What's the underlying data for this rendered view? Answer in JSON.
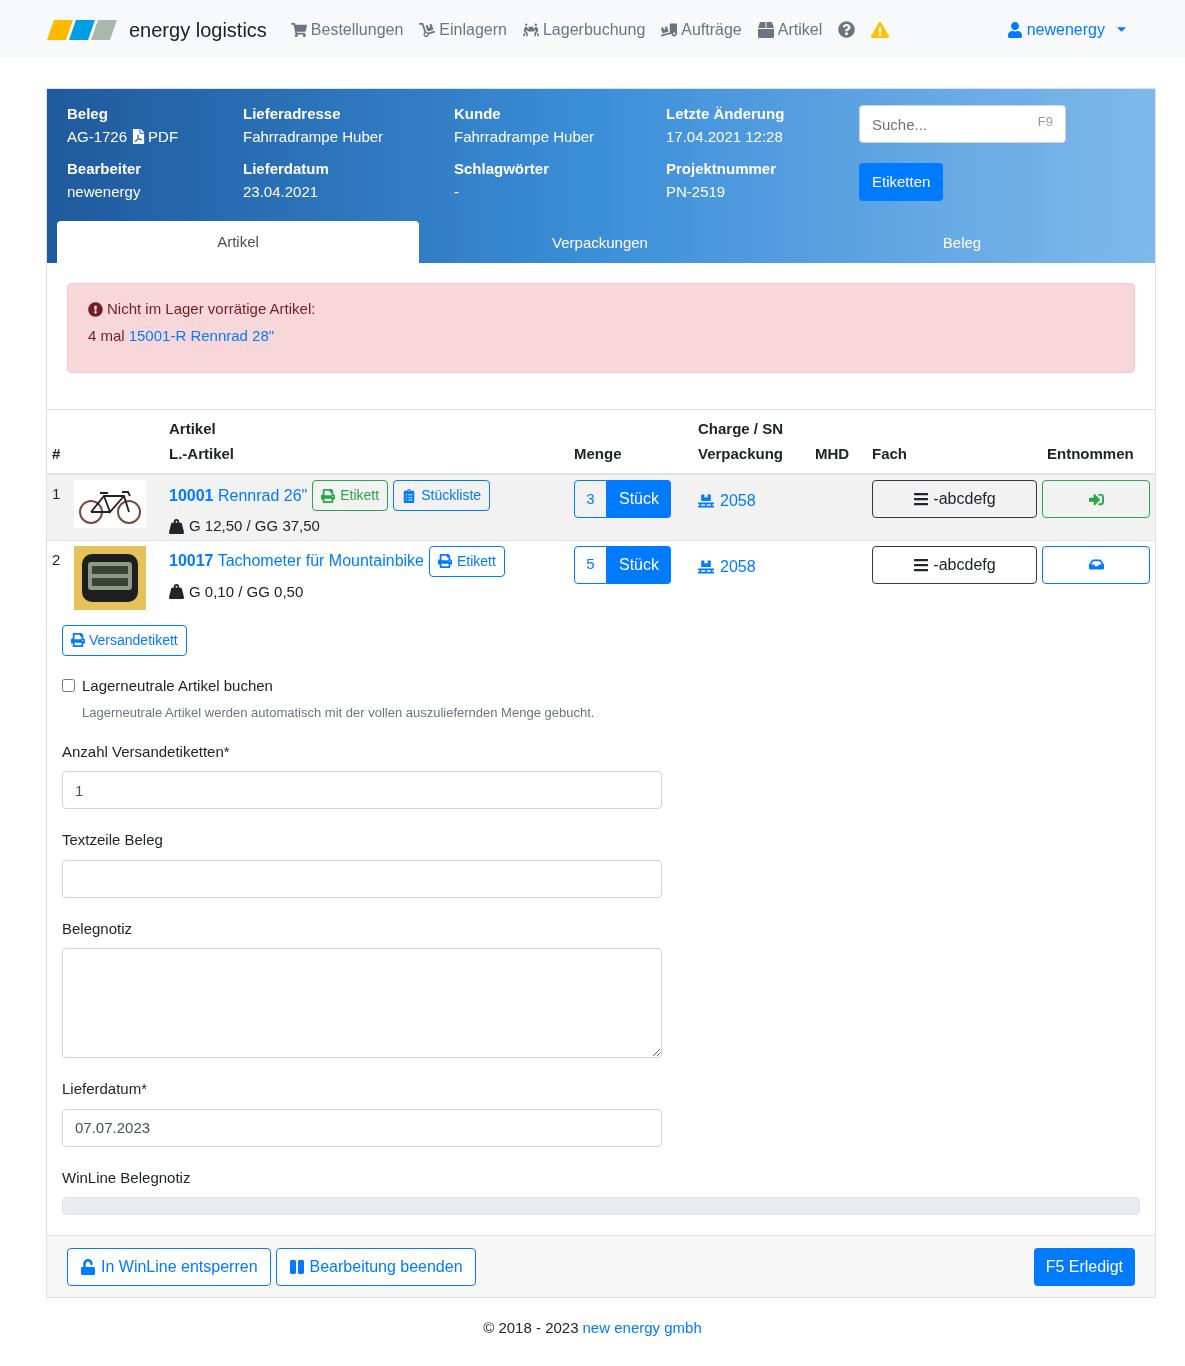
{
  "navbar": {
    "brand": "energy logistics",
    "items": [
      {
        "label": "Bestellungen",
        "kind": "cart"
      },
      {
        "label": "Einlagern",
        "kind": "dolly"
      },
      {
        "label": "Lagerbuchung",
        "kind": "people"
      },
      {
        "label": "Aufträge",
        "kind": "truck"
      },
      {
        "label": "Artikel",
        "kind": "box"
      }
    ],
    "user": "newenergy"
  },
  "header": {
    "fields": [
      {
        "label": "Beleg",
        "value": "AG-1726",
        "link": "PDF"
      },
      {
        "label": "Lieferadresse",
        "value": "Fahrradrampe Huber"
      },
      {
        "label": "Kunde",
        "value": "Fahrradrampe Huber"
      },
      {
        "label": "Letzte Änderung",
        "value": "17.04.2021 12:28"
      },
      {
        "label": "Bearbeiter",
        "value": "newenergy"
      },
      {
        "label": "Lieferdatum",
        "value": "23.04.2021"
      },
      {
        "label": "Schlagwörter",
        "value": "-"
      },
      {
        "label": "Projektnummer",
        "value": "PN-2519"
      }
    ],
    "search": {
      "placeholder": "Suche...",
      "shortcut": "F9"
    },
    "labels_button": "Etiketten",
    "tabs": [
      {
        "label": "Artikel",
        "selected": true
      },
      {
        "label": "Verpackungen",
        "selected": false
      },
      {
        "label": "Beleg",
        "selected": false
      }
    ]
  },
  "alert": {
    "title": "Nicht im Lager vorrätige Artikel:",
    "count": "4 mal",
    "link": "15001-R Rennrad 28\""
  },
  "table": {
    "columns": [
      {
        "bottom": "#"
      },
      {},
      {
        "top": "Artikel",
        "bottom": "L.-Artikel"
      },
      {
        "bottom": "Menge"
      },
      {
        "top": "Charge / SN",
        "bottom": "Verpackung"
      },
      {
        "bottom": "MHD"
      },
      {
        "bottom": "Fach"
      },
      {
        "bottom": "Entnommen"
      }
    ],
    "rows": [
      {
        "index": "1",
        "highlighted": true,
        "image": {
          "kind": "picture"
        },
        "number": "10001",
        "name": "Rennrad 26\"",
        "buttons": [
          {
            "label": "Etikett",
            "kind": "print-green"
          },
          {
            "label": "Stückliste",
            "kind": "list"
          }
        ],
        "weight": "G 12,50 / GG 37,50",
        "qty": "3",
        "unit": "Stück",
        "packaging": "2058",
        "bin": "-abcdefg",
        "taken": {
          "kind": "done"
        }
      },
      {
        "index": "2",
        "highlighted": false,
        "image": {
          "kind": "picture"
        },
        "number": "10017",
        "name": "Tachometer für Mountainbike",
        "buttons": [
          {
            "label": "Etikett",
            "kind": "print"
          }
        ],
        "weight": "G 0,10 / GG 0,50",
        "qty": "5",
        "unit": "Stück",
        "packaging": "2058",
        "bin": "-abcdefg",
        "taken": {
          "kind": "inbox"
        }
      }
    ]
  },
  "shipping_label_button": "Versandetikett",
  "neutral": {
    "label": "Lagerneutrale Artikel buchen",
    "checked": false,
    "help": "Lagerneutrale Artikel werden automatisch mit der vollen auszuliefernden Menge gebucht."
  },
  "form": [
    {
      "label": "Anzahl Versandetiketten*",
      "kind": "input",
      "value": "1"
    },
    {
      "label": "Textzeile Beleg",
      "kind": "input"
    },
    {
      "label": "Belegnotiz",
      "kind": "textarea"
    },
    {
      "label": "Lieferdatum*",
      "kind": "input",
      "value": "07.07.2023"
    },
    {
      "label": "WinLine Belegnotiz",
      "kind": "readonly"
    }
  ],
  "footer_buttons": [
    {
      "label": "In WinLine entsperren",
      "kind": "unlock"
    },
    {
      "label": "Bearbeitung beenden",
      "kind": "pause"
    }
  ],
  "done_button": "F5 Erledigt",
  "copyright": {
    "text": "© 2018 - 2023",
    "link": "new energy gmbh"
  }
}
